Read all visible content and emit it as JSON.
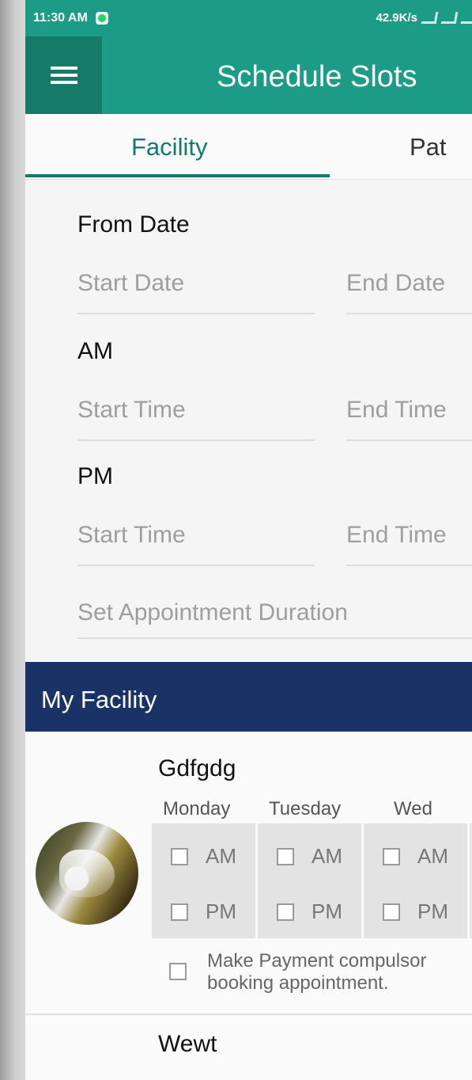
{
  "status_bar": {
    "time": "11:30 AM",
    "network_speed": "42.9K/s"
  },
  "app_bar": {
    "title": "Schedule Slots",
    "menu_icon": "hamburger-menu-icon"
  },
  "tabs": [
    {
      "label": "Facility",
      "selected": true
    },
    {
      "label": "Pat",
      "selected": false
    }
  ],
  "form": {
    "from_date_label": "From Date",
    "start_date_placeholder": "Start Date",
    "end_date_placeholder": "End Date",
    "am_label": "AM",
    "am_start_placeholder": "Start Time",
    "am_end_placeholder": "End Time",
    "pm_label": "PM",
    "pm_start_placeholder": "Start Time",
    "pm_end_placeholder": "End Time",
    "duration_placeholder": "Set Appointment Duration"
  },
  "section": {
    "title": "My Facility"
  },
  "facilities": [
    {
      "name": "Gdfgdg",
      "days": [
        "Monday",
        "Tuesday",
        "Wed"
      ],
      "slot_am": "AM",
      "slot_pm": "PM",
      "payment_text": "Make Payment compulsor booking appointment."
    },
    {
      "name": "Wewt"
    }
  ],
  "colors": {
    "primary": "#1c9b86",
    "primary_dark": "#167a68",
    "section_bar": "#1a3265"
  }
}
